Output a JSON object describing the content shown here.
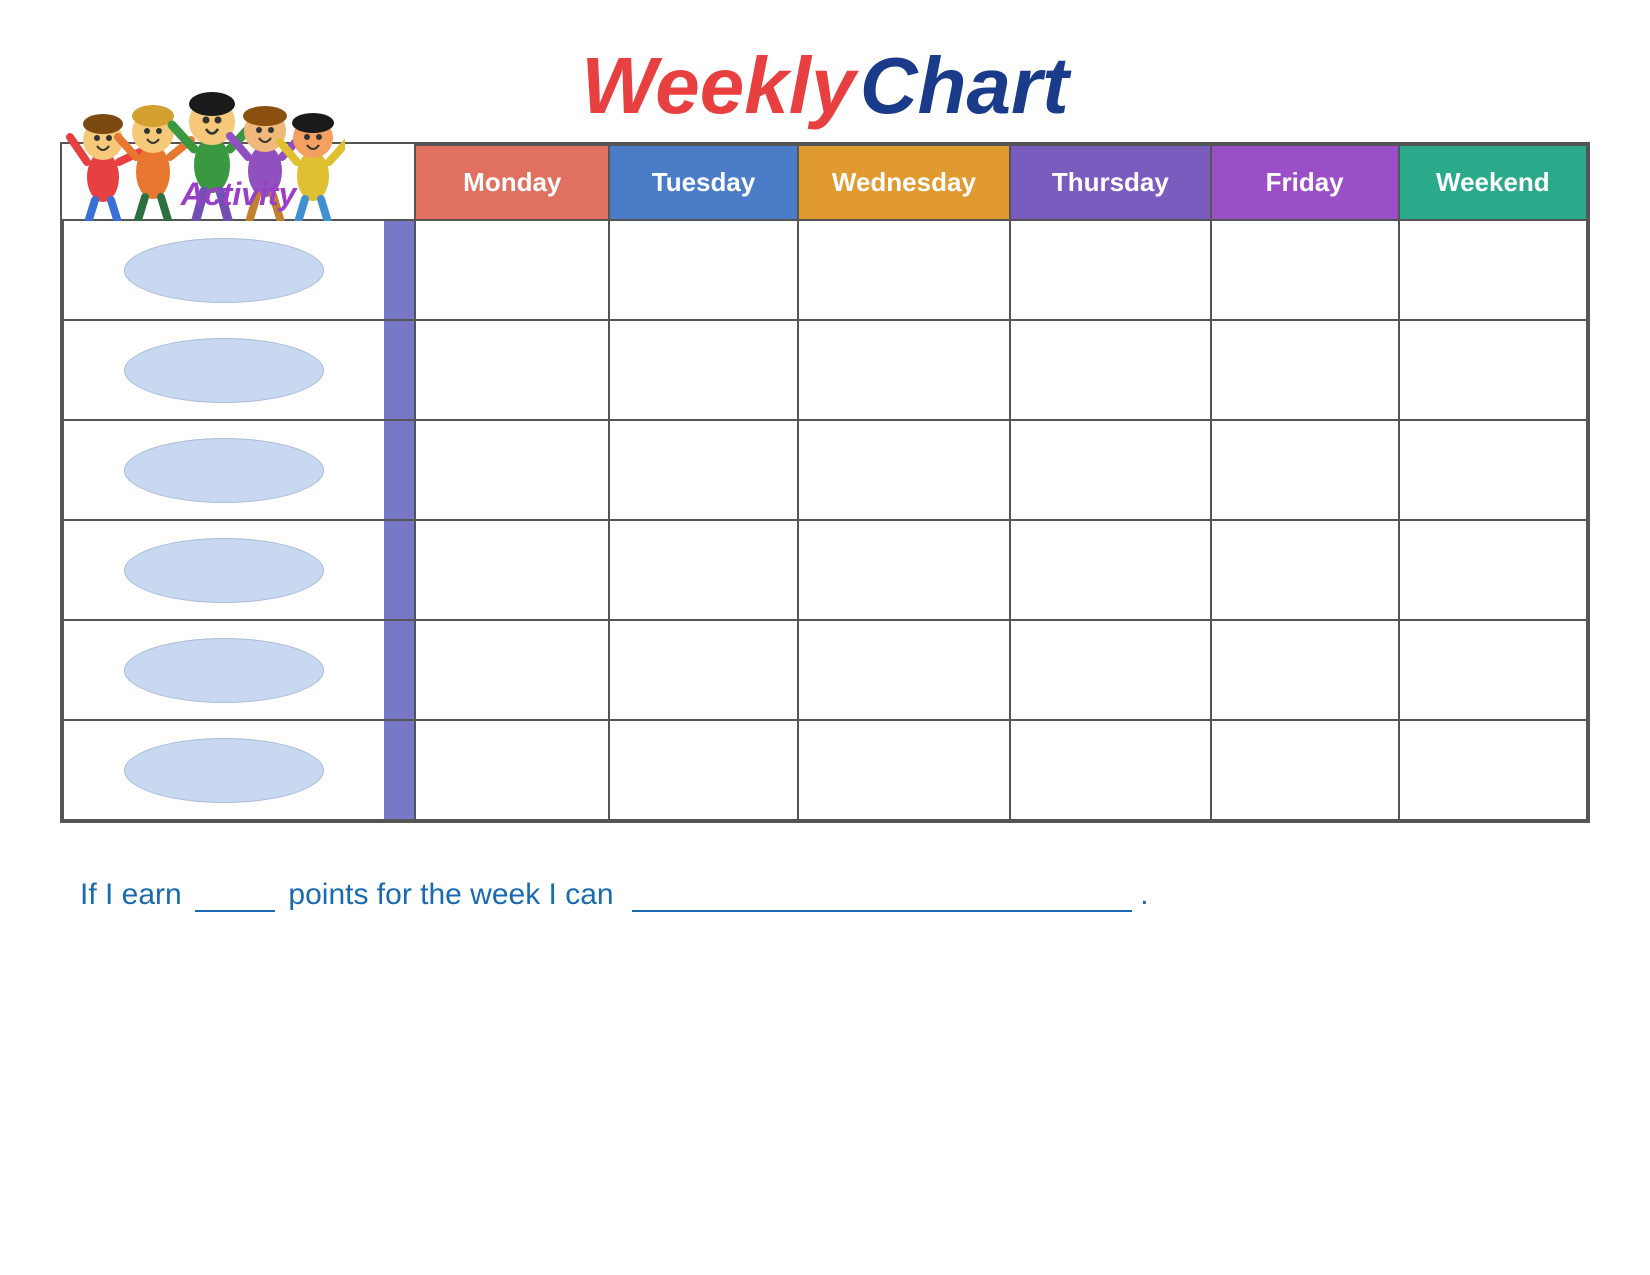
{
  "title": {
    "weekly": "Weekly",
    "chart": "Chart"
  },
  "activity_label": "Activity",
  "days": [
    {
      "label": "Monday",
      "class": "monday"
    },
    {
      "label": "Tuesday",
      "class": "tuesday"
    },
    {
      "label": "Wednesday",
      "class": "wednesday"
    },
    {
      "label": "Thursday",
      "class": "thursday"
    },
    {
      "label": "Friday",
      "class": "friday"
    },
    {
      "label": "Weekend",
      "class": "weekend"
    }
  ],
  "rows": 6,
  "footer": {
    "text_before": "If I earn",
    "text_middle": "points for the week I can",
    "text_after": "."
  }
}
